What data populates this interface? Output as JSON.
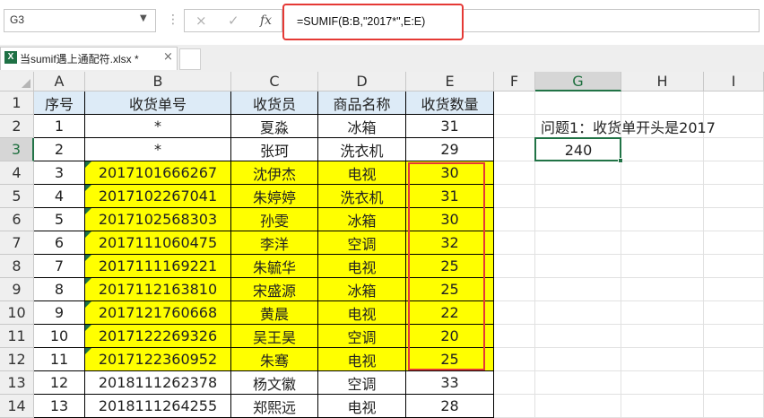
{
  "formula_bar": {
    "name_box": "G3",
    "cancel_icon": "×",
    "enter_icon": "✓",
    "fx_label": "fx",
    "formula": "=SUMIF(B:B,\"2017*\",E:E)"
  },
  "tabs": {
    "file_name": "当sumif遇上通配符.xlsx *",
    "close": "×"
  },
  "columns": [
    "A",
    "B",
    "C",
    "D",
    "E",
    "F",
    "G",
    "H",
    "I"
  ],
  "selected_column": "G",
  "selected_row": 3,
  "header_row": [
    "序号",
    "收货单号",
    "收货员",
    "商品名称",
    "收货数量"
  ],
  "rows": [
    {
      "n": "1",
      "order": "*",
      "person": "夏淼",
      "product": "冰箱",
      "qty": "31",
      "highlight": false,
      "text_num": false
    },
    {
      "n": "2",
      "order": "*",
      "person": "张珂",
      "product": "洗衣机",
      "qty": "29",
      "highlight": false,
      "text_num": false
    },
    {
      "n": "3",
      "order": "2017101666267",
      "person": "沈伊杰",
      "product": "电视",
      "qty": "30",
      "highlight": true,
      "text_num": true
    },
    {
      "n": "4",
      "order": "2017102267041",
      "person": "朱婷婷",
      "product": "洗衣机",
      "qty": "31",
      "highlight": true,
      "text_num": true
    },
    {
      "n": "5",
      "order": "2017102568303",
      "person": "孙雯",
      "product": "冰箱",
      "qty": "30",
      "highlight": true,
      "text_num": true
    },
    {
      "n": "6",
      "order": "2017111060475",
      "person": "李洋",
      "product": "空调",
      "qty": "32",
      "highlight": true,
      "text_num": true
    },
    {
      "n": "7",
      "order": "2017111169221",
      "person": "朱毓华",
      "product": "电视",
      "qty": "25",
      "highlight": true,
      "text_num": true
    },
    {
      "n": "8",
      "order": "2017112163810",
      "person": "宋盛源",
      "product": "冰箱",
      "qty": "25",
      "highlight": true,
      "text_num": true
    },
    {
      "n": "9",
      "order": "2017121760668",
      "person": "黄晨",
      "product": "电视",
      "qty": "22",
      "highlight": true,
      "text_num": true
    },
    {
      "n": "10",
      "order": "2017122269326",
      "person": "吴王昊",
      "product": "空调",
      "qty": "20",
      "highlight": true,
      "text_num": true
    },
    {
      "n": "11",
      "order": "2017122360952",
      "person": "朱骞",
      "product": "电视",
      "qty": "25",
      "highlight": true,
      "text_num": true
    },
    {
      "n": "12",
      "order": "2018111262378",
      "person": "杨文徽",
      "product": "空调",
      "qty": "33",
      "highlight": false,
      "text_num": false
    },
    {
      "n": "13",
      "order": "2018111264255",
      "person": "郑熙远",
      "product": "电视",
      "qty": "28",
      "highlight": false,
      "text_num": false
    }
  ],
  "question": {
    "label": "问题1：收货单开头是2017",
    "answer": "240"
  },
  "colors": {
    "highlight": "#ffff00",
    "annotation": "#e53935",
    "header_fill": "#ddebf7",
    "selection": "#217346"
  }
}
